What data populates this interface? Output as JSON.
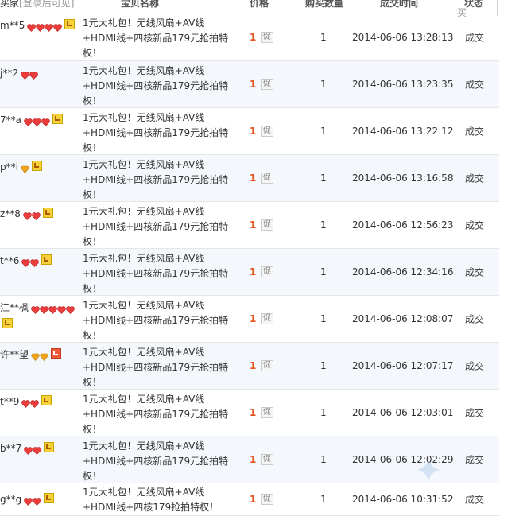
{
  "header": {
    "buyer": "买家",
    "buyer_hint": "[登录后可见]",
    "item": "宝贝名称",
    "price": "价格",
    "qty": "购买数量",
    "time": "成交时间",
    "status": "状态",
    "corner_glyph": "买"
  },
  "colors": {
    "heart": "#ec3d3d",
    "diamond": "#f1a51a",
    "price": "#e4521a",
    "alt_row": "#f4f8fc"
  },
  "rows": [
    {
      "buyer": "m**5",
      "level": "4 hearts",
      "item": "1元大礼包！无线风扇+AV线+HDMI线+四核新品179元抢拍特权！",
      "price": "1",
      "promo": "促",
      "qty": "1",
      "time": "2014-06-06 13:28:13",
      "status": "成交"
    },
    {
      "buyer": "j**2",
      "level": "2 hearts",
      "item": "1元大礼包！无线风扇+AV线+HDMI线+四核新品179元抢拍特权！",
      "price": "1",
      "promo": "促",
      "qty": "1",
      "time": "2014-06-06 13:23:35",
      "status": "成交"
    },
    {
      "buyer": "7**a",
      "level": "3 hearts",
      "item": "1元大礼包！无线风扇+AV线+HDMI线+四核新品179元抢拍特权！",
      "price": "1",
      "promo": "促",
      "qty": "1",
      "time": "2014-06-06 13:22:12",
      "status": "成交"
    },
    {
      "buyer": "p**i",
      "level": "1 diamond",
      "item": "1元大礼包！无线风扇+AV线+HDMI线+四核新品179元抢拍特权！",
      "price": "1",
      "promo": "促",
      "qty": "1",
      "time": "2014-06-06 13:16:58",
      "status": "成交"
    },
    {
      "buyer": "z**8",
      "level": "2 hearts",
      "item": "1元大礼包！无线风扇+AV线+HDMI线+四核新品179元抢拍特权！",
      "price": "1",
      "promo": "促",
      "qty": "1",
      "time": "2014-06-06 12:56:23",
      "status": "成交"
    },
    {
      "buyer": "t**6",
      "level": "2 hearts",
      "item": "1元大礼包！无线风扇+AV线+HDMI线+四核新品179元抢拍特权！",
      "price": "1",
      "promo": "促",
      "qty": "1",
      "time": "2014-06-06 12:34:16",
      "status": "成交"
    },
    {
      "buyer": "江**枫",
      "level": "5 hearts",
      "item": "1元大礼包！无线风扇+AV线+HDMI线+四核新品179元抢拍特权！",
      "price": "1",
      "promo": "促",
      "qty": "1",
      "time": "2014-06-06 12:08:07",
      "status": "成交"
    },
    {
      "buyer": "许**望",
      "level": "2 diamonds",
      "item": "1元大礼包！无线风扇+AV线+HDMI线+四核新品179元抢拍特权！",
      "price": "1",
      "promo": "促",
      "qty": "1",
      "time": "2014-06-06 12:07:17",
      "status": "成交"
    },
    {
      "buyer": "t**9",
      "level": "2 hearts",
      "item": "1元大礼包！无线风扇+AV线+HDMI线+四核新品179元抢拍特权！",
      "price": "1",
      "promo": "促",
      "qty": "1",
      "time": "2014-06-06 12:03:01",
      "status": "成交"
    },
    {
      "buyer": "b**7",
      "level": "2 hearts",
      "item": "1元大礼包！无线风扇+AV线+HDMI线+四核新品179元抢拍特权！",
      "price": "1",
      "promo": "促",
      "qty": "1",
      "time": "2014-06-06 12:02:29",
      "status": "成交"
    },
    {
      "buyer": "g**g",
      "level": "2 hearts",
      "item": "1元大礼包！无线风扇+AV线+HDMI线+四核179抢拍特权！",
      "price": "1",
      "promo": "促",
      "qty": "1",
      "time": "2014-06-06 10:31:52",
      "status": "成交"
    }
  ]
}
